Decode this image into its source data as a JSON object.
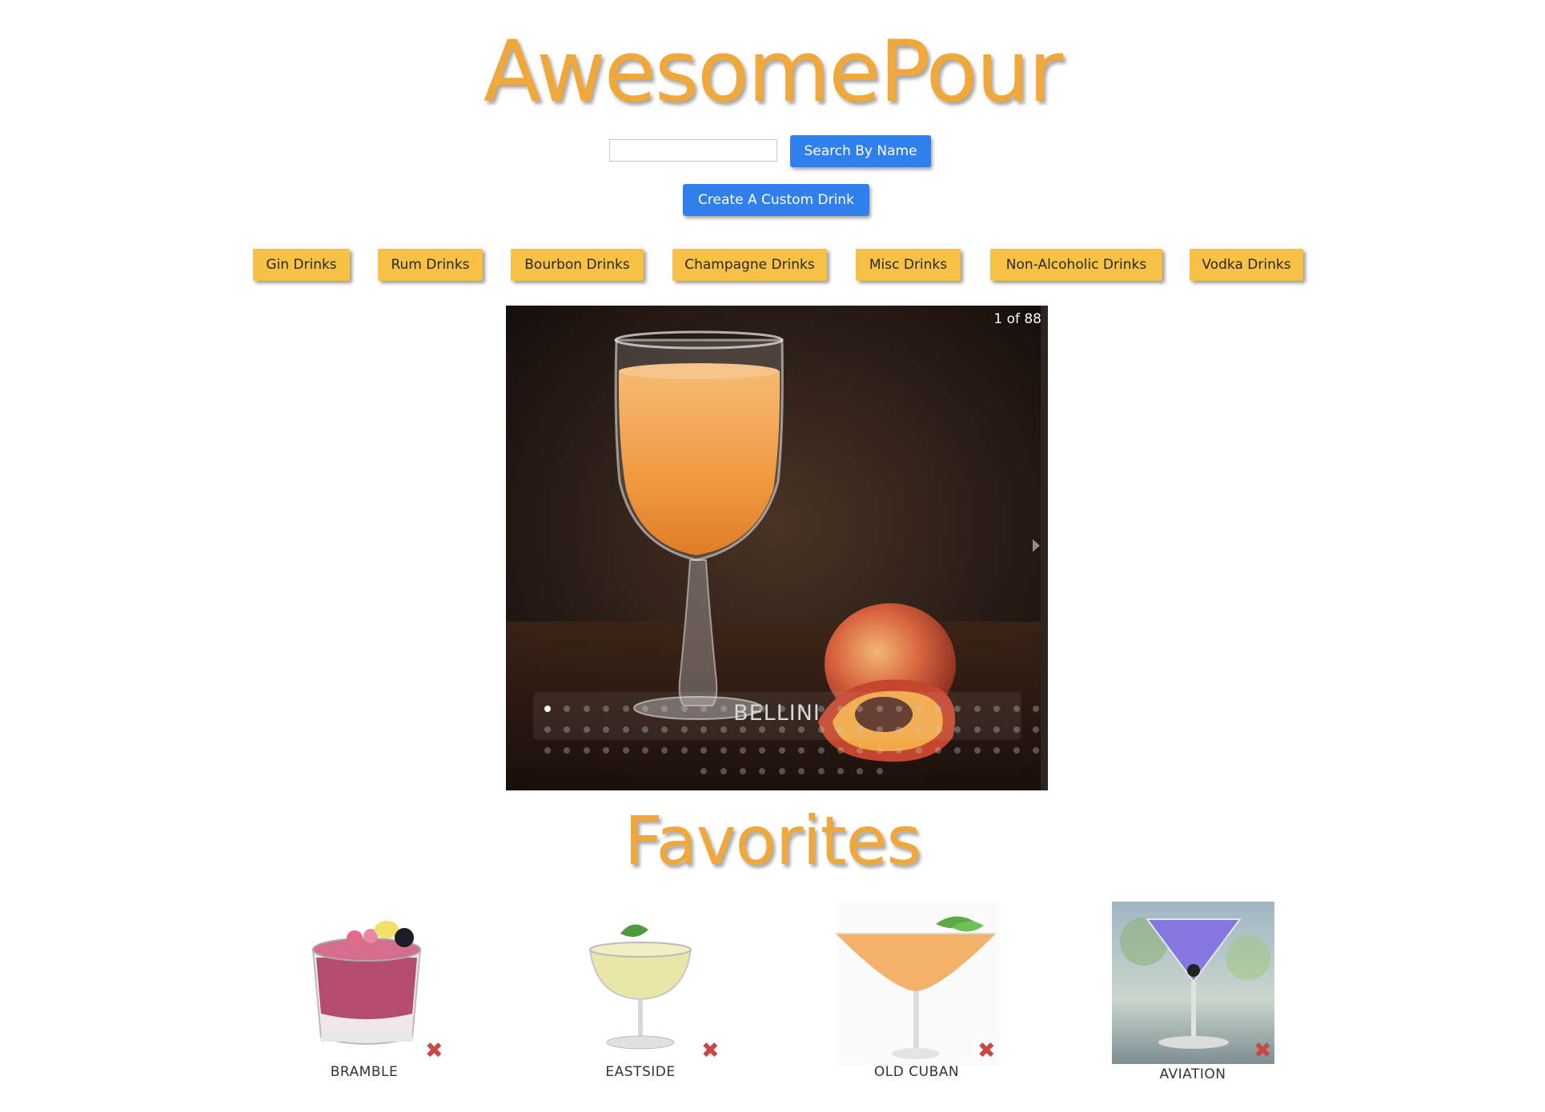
{
  "header": {
    "title": "AwesomePour"
  },
  "search": {
    "placeholder": "",
    "value": "",
    "button_label": "Search By Name"
  },
  "create": {
    "button_label": "Create A Custom Drink"
  },
  "categories": [
    {
      "label": "Gin Drinks"
    },
    {
      "label": "Rum Drinks"
    },
    {
      "label": "Bourbon Drinks"
    },
    {
      "label": "Champagne Drinks"
    },
    {
      "label": "Misc Drinks"
    },
    {
      "label": "Non-Alcoholic Drinks"
    },
    {
      "label": "Vodka Drinks"
    }
  ],
  "slideshow": {
    "counter": "1 of 88",
    "caption": "BELLINI",
    "current_index": 1,
    "total": 88
  },
  "favorites": {
    "title": "Favorites",
    "items": [
      {
        "name": "BRAMBLE"
      },
      {
        "name": "EASTSIDE"
      },
      {
        "name": "OLD CUBAN"
      },
      {
        "name": "AVIATION"
      }
    ]
  },
  "colors": {
    "title_orange": "#f0a83a",
    "button_blue": "#2f7fec",
    "category_yellow": "#f6c145",
    "remove_red": "#cd4646"
  },
  "icons": {
    "remove": "close-x-icon",
    "next": "chevron-right-icon"
  }
}
